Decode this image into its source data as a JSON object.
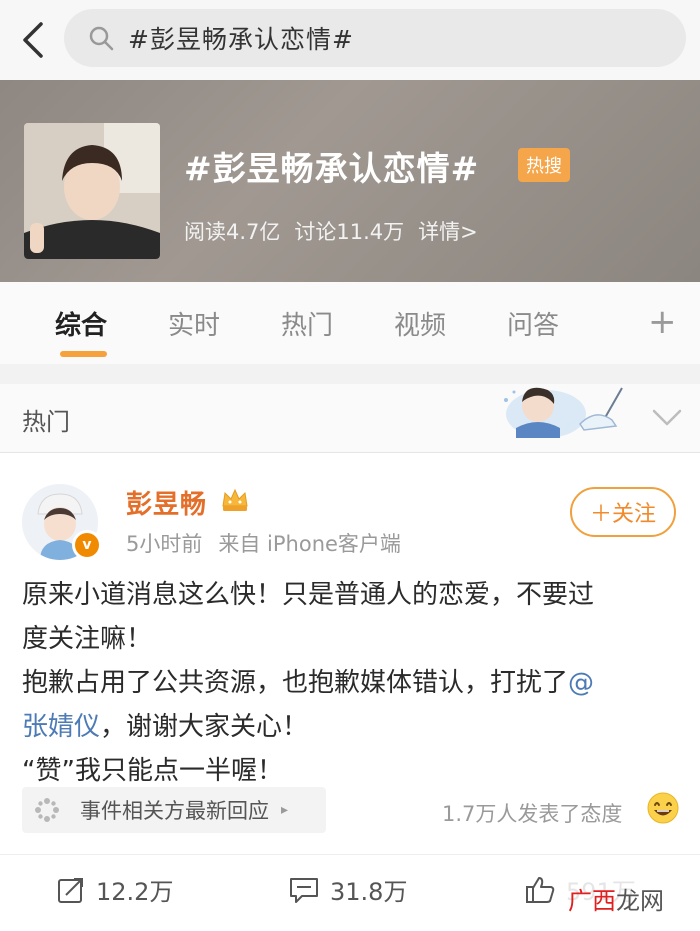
{
  "search": {
    "query": "#彭昱畅承认恋情#"
  },
  "topic": {
    "title": "#彭昱畅承认恋情#",
    "badge": "热搜",
    "reads": "阅读4.7亿",
    "discussions": "讨论11.4万",
    "details": "详情>"
  },
  "tabs": [
    {
      "label": "综合"
    },
    {
      "label": "实时"
    },
    {
      "label": "热门"
    },
    {
      "label": "视频"
    },
    {
      "label": "问答"
    }
  ],
  "tab_add": "+",
  "section": {
    "label": "热门"
  },
  "post": {
    "author": "彭昱畅",
    "verified_mark": "v",
    "time": "5小时前",
    "source": "来自 iPhone客户端",
    "follow_label": "＋关注",
    "lines": {
      "l1": "原来小道消息这么快！只是普通人的恋爱，不要过",
      "l2": "度关注嘛！",
      "l3a": "抱歉占用了公共资源，也抱歉媒体错认，打扰了",
      "l3b": "@",
      "l4a": "张婧仪",
      "l4b": "，谢谢大家关心！",
      "l5": "“赞”我只能点一半喔！"
    },
    "event_label": "事件相关方最新回应",
    "event_arrow": "▸",
    "attitude": "1.7万人发表了态度",
    "actions": {
      "reposts": "12.2万",
      "comments": "31.8万",
      "likes": "591万"
    }
  },
  "watermark": {
    "part1": "广西",
    "part2": "龙网"
  },
  "colors": {
    "accent": "#f5a23c",
    "author": "#e46f2a",
    "mention": "#4d7bb5",
    "hot_badge": "#f5a54a"
  },
  "icons": [
    "back-icon",
    "search-icon",
    "crown-icon",
    "chevron-down-icon",
    "event-icon",
    "emoji-icon",
    "repost-icon",
    "comment-icon",
    "like-icon"
  ]
}
